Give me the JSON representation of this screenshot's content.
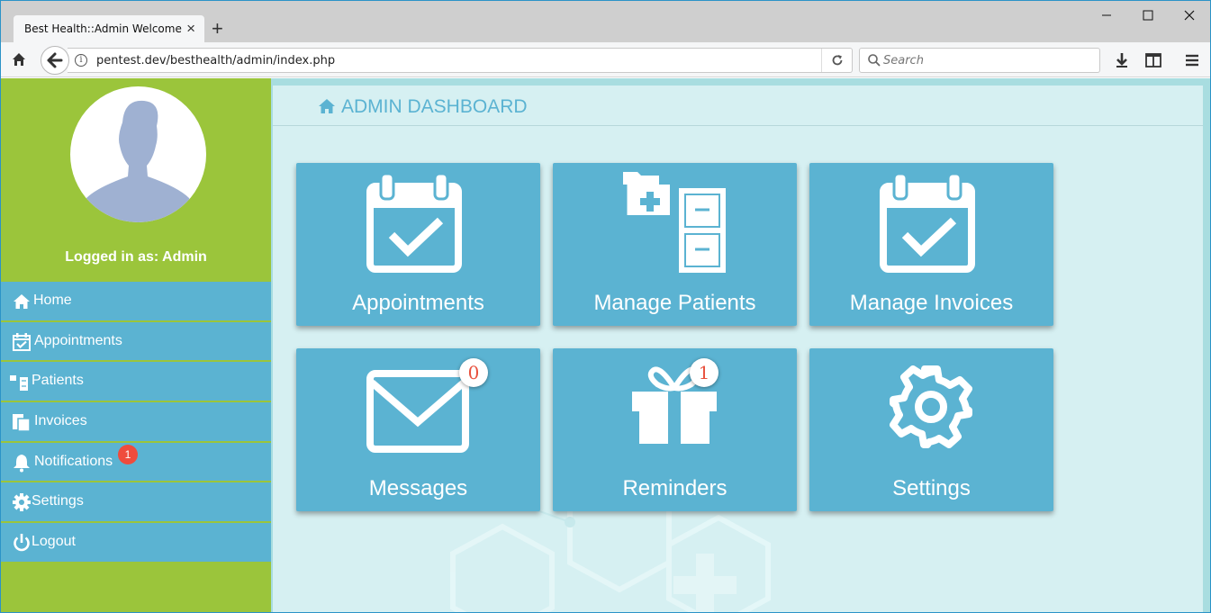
{
  "browser": {
    "tab_title": "Best Health::Admin Welcome",
    "url": "pentest.dev/besthealth/admin/index.php",
    "search_placeholder": "Search"
  },
  "sidebar": {
    "logged_in_text": "Logged in as: Admin",
    "notifications_count": "1",
    "items": [
      {
        "label": "Home",
        "icon": "home-icon"
      },
      {
        "label": "Appointments",
        "icon": "calendar-check-icon"
      },
      {
        "label": "Patients",
        "icon": "patients-icon"
      },
      {
        "label": "Invoices",
        "icon": "invoices-icon"
      },
      {
        "label": "Notifications",
        "icon": "bell-icon"
      },
      {
        "label": "Settings",
        "icon": "gear-icon"
      },
      {
        "label": "Logout",
        "icon": "power-icon"
      }
    ]
  },
  "dashboard": {
    "title": "ADMIN DASHBOARD",
    "tiles": [
      {
        "label": "Appointments",
        "icon": "calendar-check-icon"
      },
      {
        "label": "Manage Patients",
        "icon": "patient-files-icon"
      },
      {
        "label": "Manage Invoices",
        "icon": "calendar-check-icon"
      },
      {
        "label": "Messages",
        "icon": "envelope-icon",
        "badge": "0"
      },
      {
        "label": "Reminders",
        "icon": "gift-icon",
        "badge": "1"
      },
      {
        "label": "Settings",
        "icon": "gear-icon"
      }
    ]
  },
  "colors": {
    "sidebar_green": "#9bc53b",
    "accent_blue": "#5bb3d2",
    "badge_red": "#ef4c3d"
  }
}
